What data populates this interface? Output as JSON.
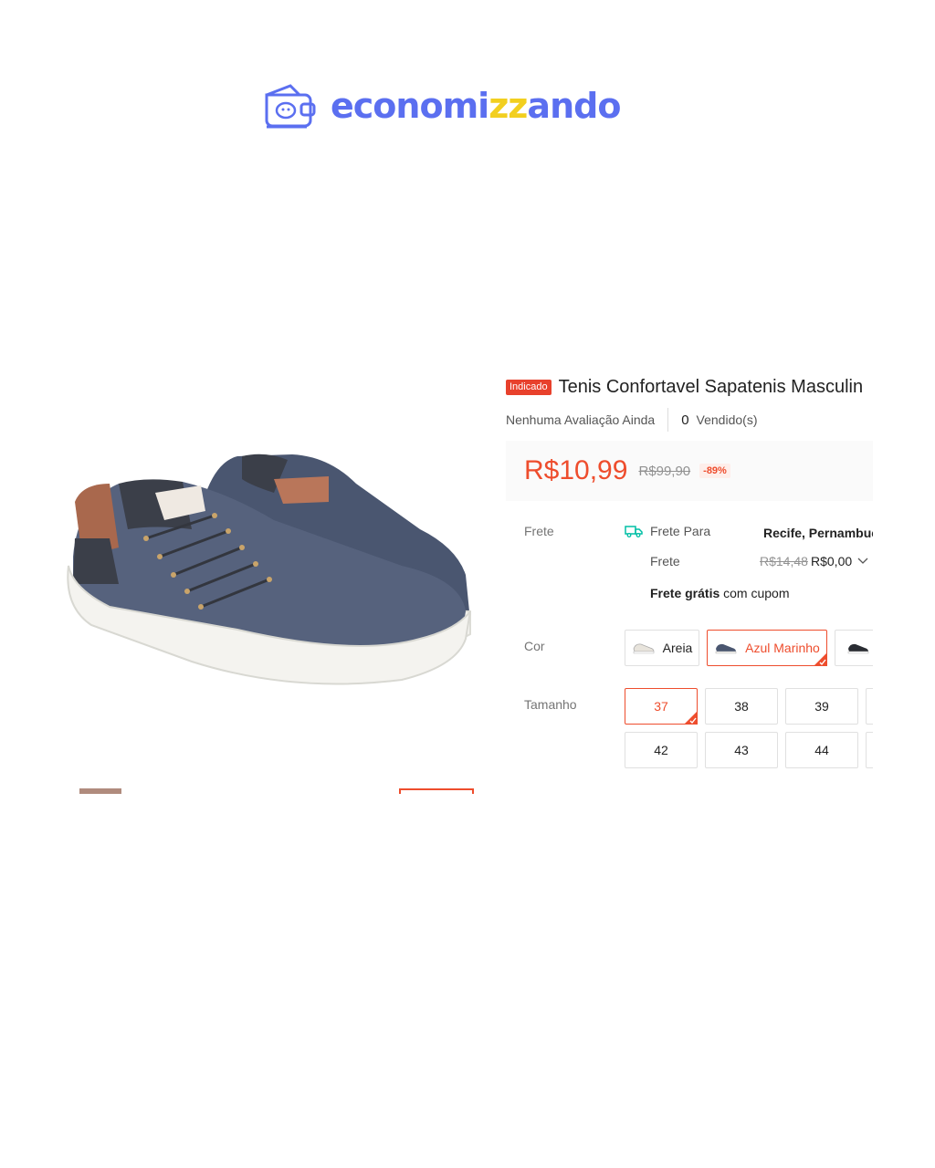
{
  "logo": {
    "text_prefix": "economi",
    "text_zz": "zz",
    "text_suffix": "ando"
  },
  "product": {
    "badge": "Indicado",
    "title": "Tenis Confortavel Sapatenis Masculin",
    "rating_text": "Nenhuma Avaliação Ainda",
    "sold_count": "0",
    "sold_label": "Vendido(s)",
    "price": "R$10,99",
    "old_price": "R$99,90",
    "discount": "-89%"
  },
  "shipping": {
    "label": "Frete",
    "to_label": "Frete Para",
    "city": "Recife, Pernambuco",
    "cost_label": "Frete",
    "old_cost": "R$14,48",
    "new_cost": "R$0,00",
    "free_bold": "Frete grátis",
    "free_rest": " com cupom"
  },
  "color": {
    "label": "Cor",
    "options": [
      "Areia",
      "Azul Marinho",
      ""
    ],
    "selected": "Azul Marinho"
  },
  "size": {
    "label": "Tamanho",
    "row1": [
      "37",
      "38",
      "39",
      ""
    ],
    "row2": [
      "42",
      "43",
      "44",
      ""
    ],
    "selected": "37"
  },
  "colors": {
    "accent": "#ee4d2d",
    "logo_blue": "#5b6ff0",
    "logo_yellow": "#f2cf1f"
  },
  "icons": [
    "logo-wallet-icon",
    "truck-icon",
    "chevron-down-icon",
    "check-corner-icon"
  ]
}
